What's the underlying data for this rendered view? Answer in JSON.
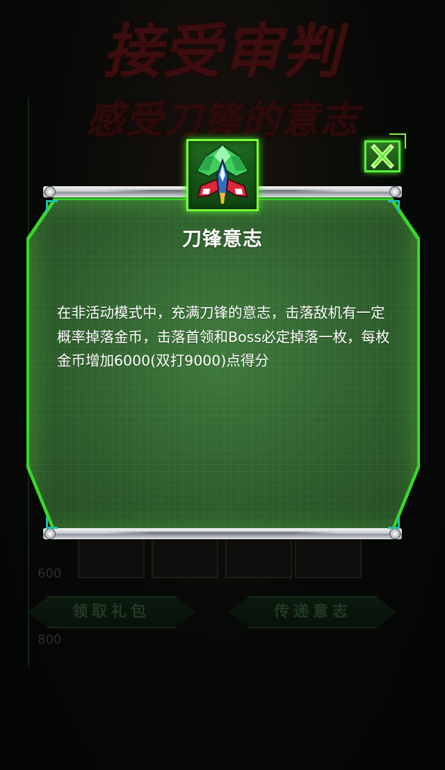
{
  "background": {
    "title_line_1": "接受审判",
    "title_line_2": "感受刀锋的意志",
    "score_labels": [
      "600",
      "800"
    ],
    "buttons": {
      "claim_gift": "领取礼包",
      "pass_will": "传递意志"
    }
  },
  "dialog": {
    "title": "刀锋意志",
    "description": "在非活动模式中，充满刀锋的意志，击落敌机有一定概率掉落金币，击落首领和Boss必定掉落一枚，每枚金币增加6000(双打9000)点得分",
    "emblem_icon": "fighter-jet-icon",
    "close_icon": "close-x-icon"
  },
  "colors": {
    "panel_green": "#2f5f2d",
    "glow_green": "#39d62a",
    "accent_green": "#7dff3c",
    "title_red": "#3c0d0e"
  }
}
